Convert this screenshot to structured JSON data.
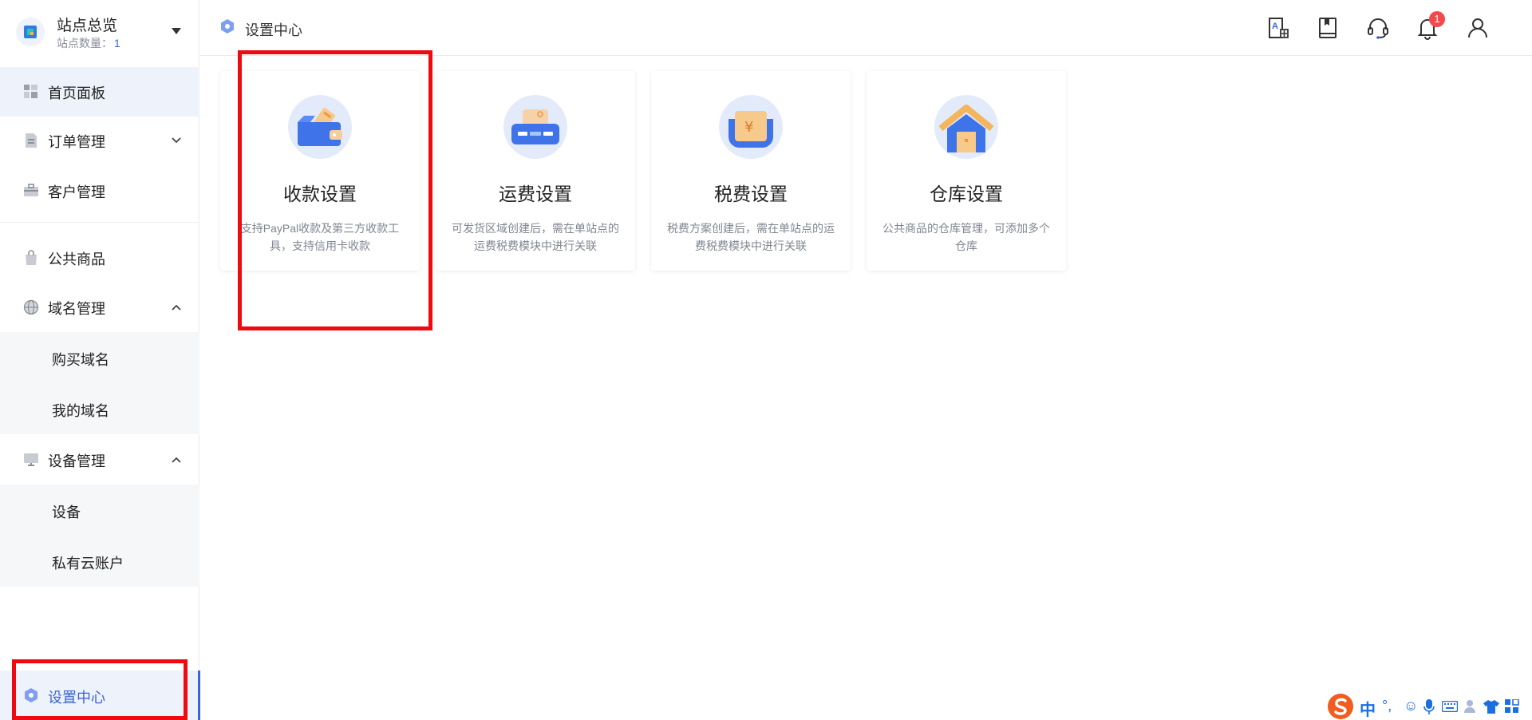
{
  "sidebar": {
    "site_title": "站点总览",
    "site_count_label": "站点数量：",
    "site_count_value": "1",
    "items": {
      "dashboard": "首页面板",
      "orders": "订单管理",
      "customers": "客户管理",
      "public_goods": "公共商品",
      "domains": "域名管理",
      "buy_domain": "购买域名",
      "my_domains": "我的域名",
      "devices": "设备管理",
      "device": "设备",
      "private_cloud": "私有云账户",
      "settings": "设置中心"
    }
  },
  "header": {
    "breadcrumb": "设置中心",
    "notification_count": "1",
    "icons": [
      "translate-icon",
      "book-icon",
      "headset-icon",
      "bell-icon",
      "user-icon"
    ]
  },
  "cards": [
    {
      "title": "收款设置",
      "desc": "支持PayPal收款及第三方收款工具，支持信用卡收款",
      "icon": "wallet-icon"
    },
    {
      "title": "运费设置",
      "desc": "可发货区域创建后，需在单站点的运费税费模块中进行关联",
      "icon": "shipping-icon"
    },
    {
      "title": "税费设置",
      "desc": "税费方案创建后，需在单站点的运费税费模块中进行关联",
      "icon": "tax-icon"
    },
    {
      "title": "仓库设置",
      "desc": "公共商品的仓库管理，可添加多个仓库",
      "icon": "warehouse-icon"
    }
  ],
  "ime": {
    "lang": "中"
  },
  "colors": {
    "accent": "#3a64d8",
    "annotation": "#ee0a10",
    "badge": "#f5484d"
  }
}
